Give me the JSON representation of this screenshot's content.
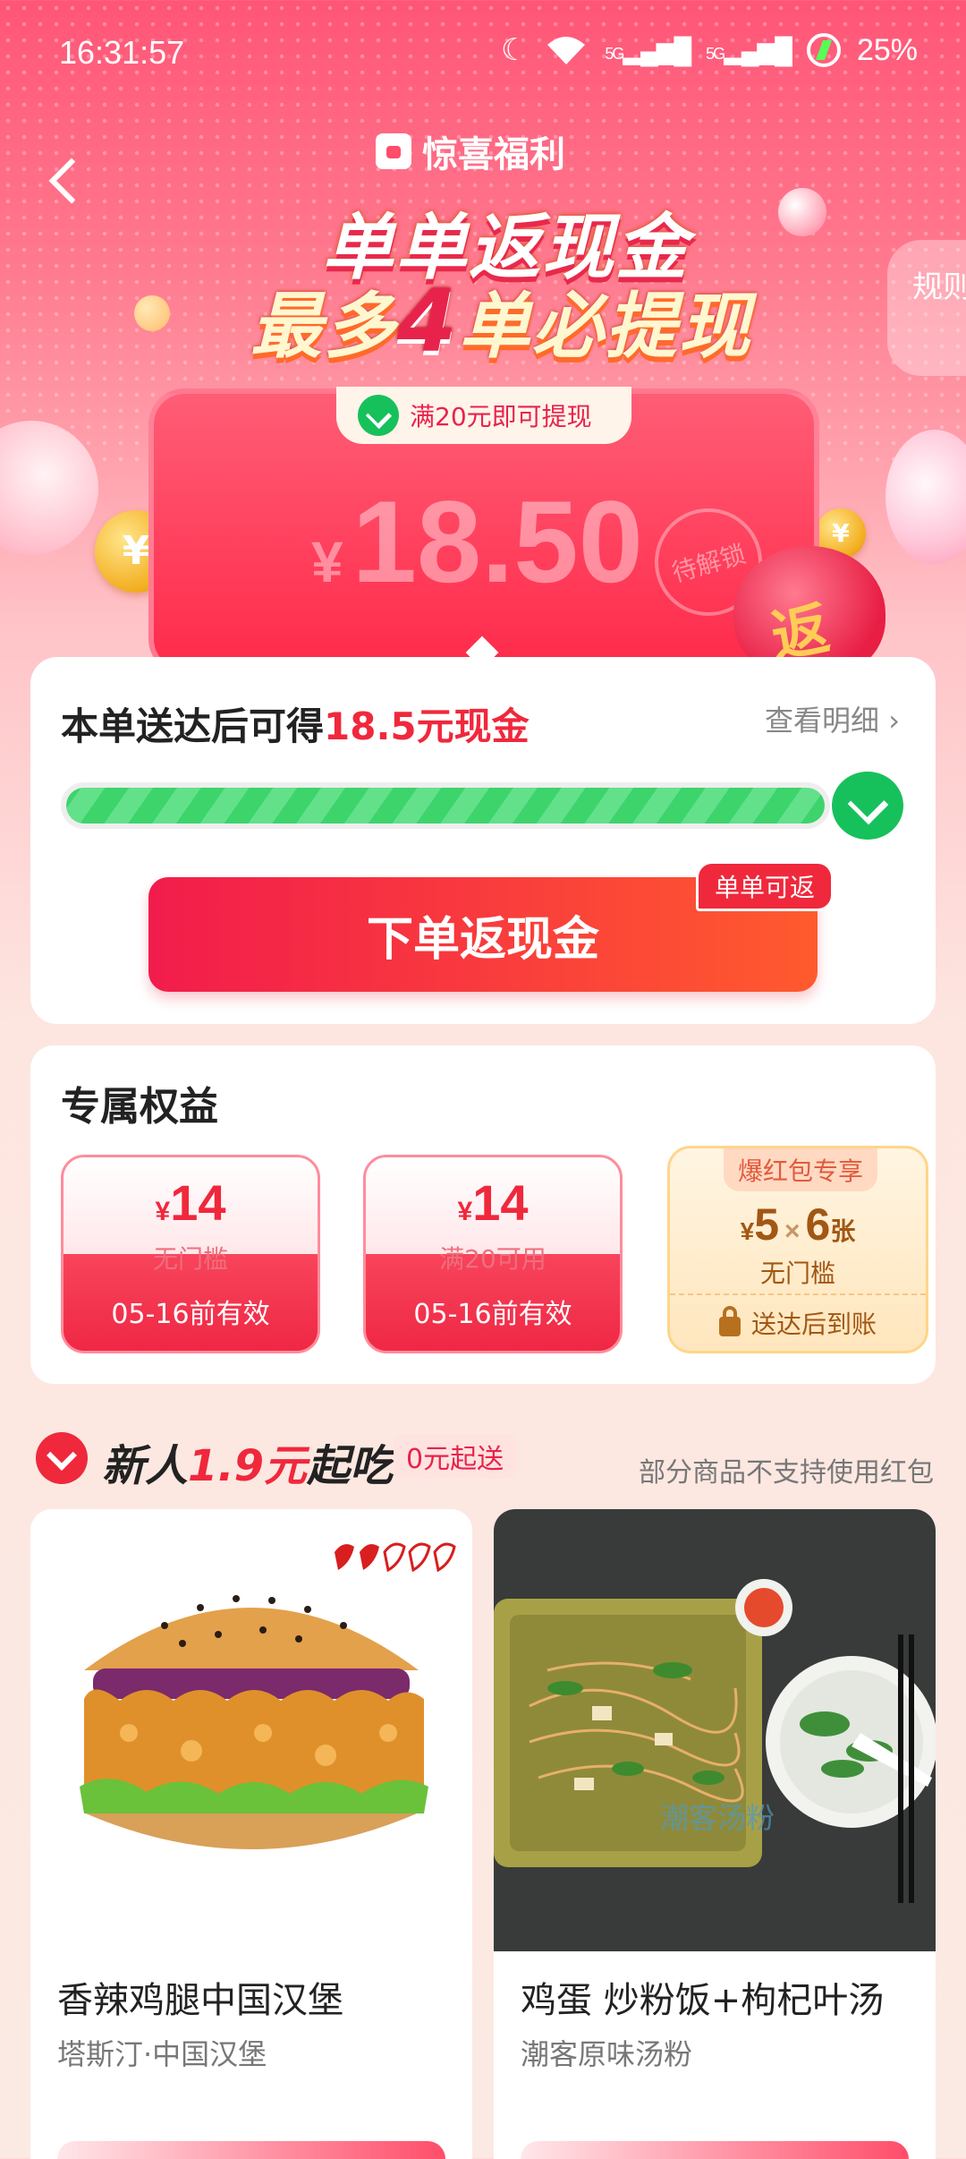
{
  "status_bar": {
    "time": "16:31:57",
    "network1": "5G",
    "network2": "5G",
    "battery": "25%"
  },
  "header": {
    "brand": "惊喜福利",
    "headline_line1": "单单返现金",
    "headline_line2_pre": "最多",
    "headline_line2_num": "4",
    "headline_line2_post": "单必提现",
    "rules_label": "规则"
  },
  "cash_card": {
    "condition": "满20元即可提现",
    "currency": "¥",
    "amount": "18.50",
    "stamp": "待解锁",
    "bag_char": "返"
  },
  "progress": {
    "title_pre": "本单送达后可得",
    "title_highlight": "18.5元现金",
    "detail_link": "查看明细",
    "progress_value": 1.0,
    "cta_label": "下单返现金",
    "cta_badge": "单单可返"
  },
  "benefits": {
    "title": "专属权益",
    "coupons": [
      {
        "currency": "¥",
        "amount": "14",
        "condition": "无门槛",
        "validity": "05-16前有效"
      },
      {
        "currency": "¥",
        "amount": "14",
        "condition": "满20可用",
        "validity": "05-16前有效"
      }
    ],
    "special": {
      "badge": "爆红包专享",
      "currency": "¥",
      "amount": "5",
      "times": "×",
      "count": "6",
      "unit": "张",
      "condition": "无门槛",
      "footer": "送达后到账"
    }
  },
  "newcomer": {
    "title_pre": "新人",
    "title_highlight": "1.9元",
    "title_post": "起吃",
    "pill": "0元起送",
    "note": "部分商品不支持使用红包"
  },
  "foods": [
    {
      "name": "香辣鸡腿中国汉堡",
      "shop": "塔斯汀·中国汉堡"
    },
    {
      "name": "鸡蛋 炒粉饭+枸杞叶汤",
      "shop": "潮客原味汤粉",
      "watermark": "潮客汤粉"
    }
  ],
  "colors": {
    "accent": "#f0283c",
    "progress": "#3dd46c",
    "gold": "#a25714"
  }
}
